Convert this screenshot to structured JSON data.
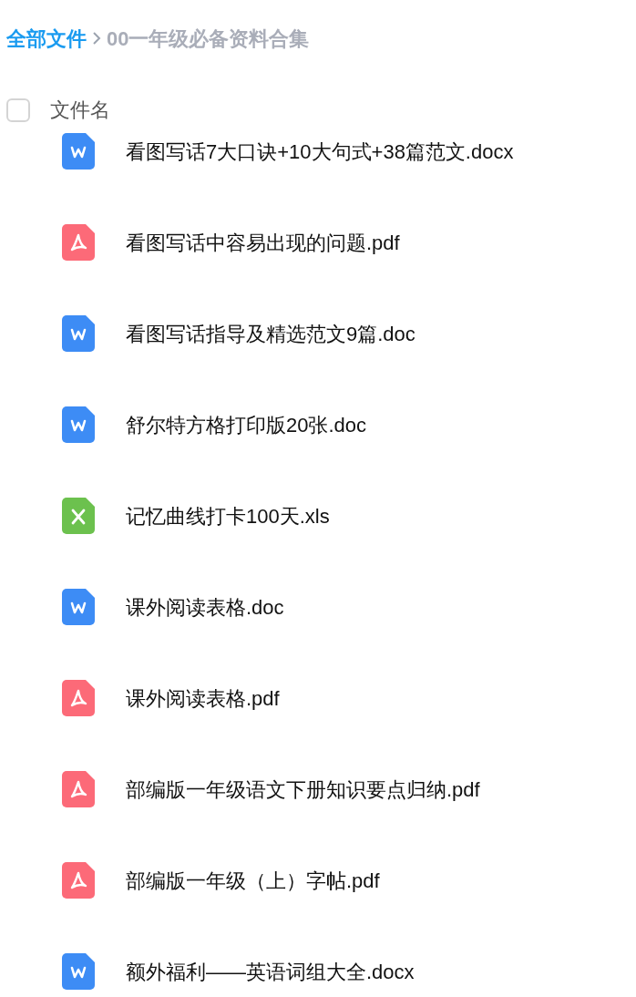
{
  "breadcrumb": [
    {
      "label": "全部文件",
      "current": false
    },
    {
      "label": "00一年级必备资料合集",
      "current": true
    }
  ],
  "header": {
    "checked": false,
    "label": "文件名"
  },
  "files": [
    {
      "kind": "word",
      "name": "看图写话7大口诀+10大句式+38篇范文.docx"
    },
    {
      "kind": "pdf",
      "name": "看图写话中容易出现的问题.pdf"
    },
    {
      "kind": "word",
      "name": "看图写话指导及精选范文9篇.doc"
    },
    {
      "kind": "word",
      "name": "舒尔特方格打印版20张.doc"
    },
    {
      "kind": "excel",
      "name": "记忆曲线打卡100天.xls"
    },
    {
      "kind": "word",
      "name": "课外阅读表格.doc"
    },
    {
      "kind": "pdf",
      "name": "课外阅读表格.pdf"
    },
    {
      "kind": "pdf",
      "name": "部编版一年级语文下册知识要点归纳.pdf"
    },
    {
      "kind": "pdf",
      "name": "部编版一年级（上）字帖.pdf"
    },
    {
      "kind": "word",
      "name": "额外福利——英语词组大全.docx"
    }
  ]
}
